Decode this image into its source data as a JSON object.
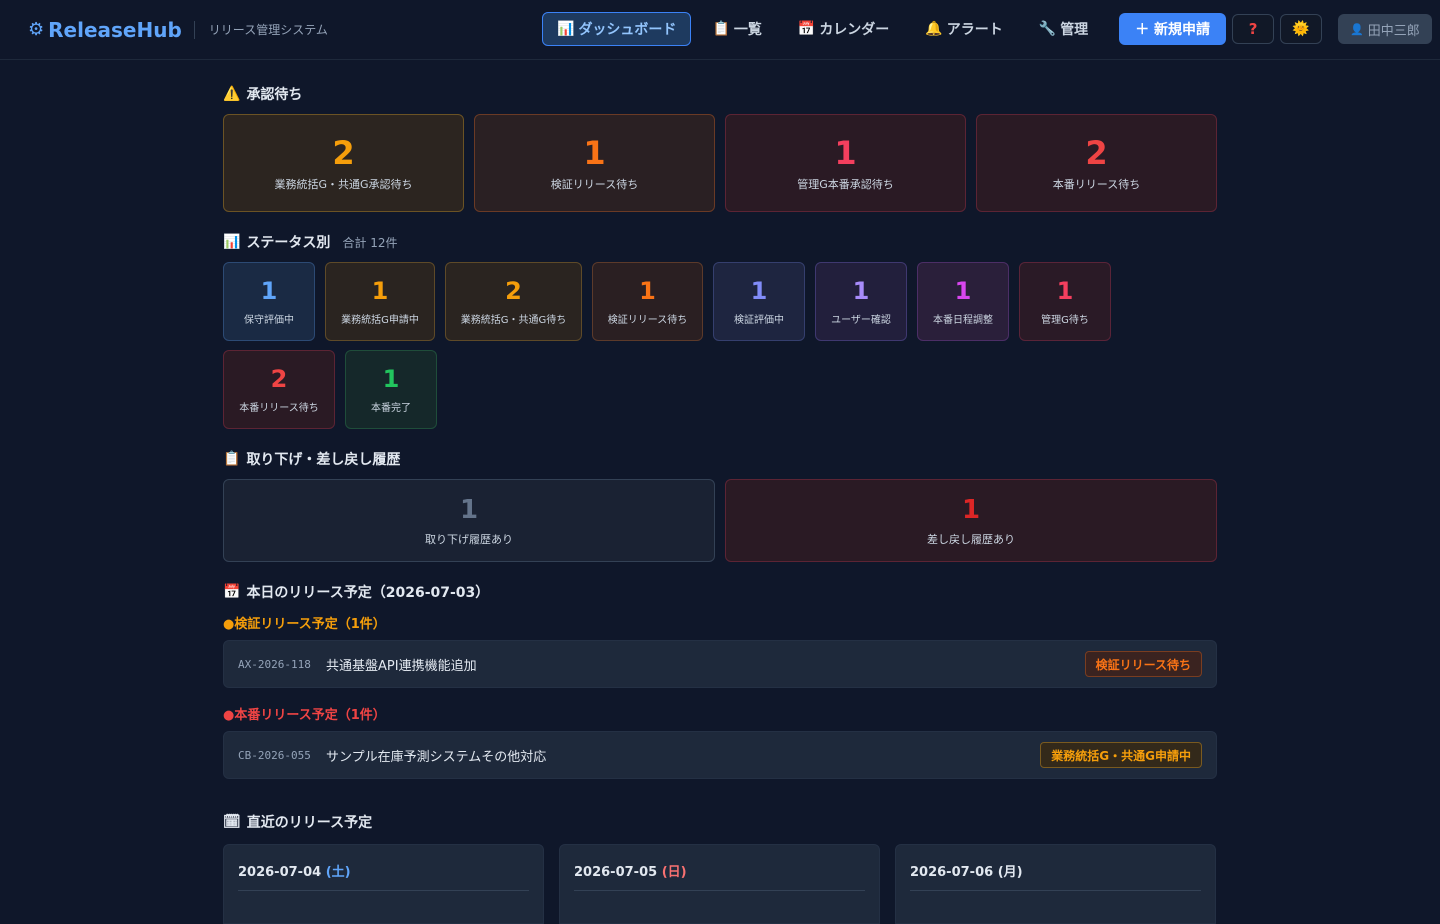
{
  "header": {
    "brand": "ReleaseHub",
    "brand_icon": "gear-icon",
    "subtitle": "リリース管理システム",
    "nav": [
      {
        "icon": "📊",
        "label": "ダッシュボード",
        "active": true
      },
      {
        "icon": "📋",
        "label": "一覧"
      },
      {
        "icon": "📅",
        "label": "カレンダー"
      },
      {
        "icon": "🔔",
        "label": "アラート"
      },
      {
        "icon": "🔧",
        "label": "管理"
      }
    ],
    "new_button": "＋ 新規申請",
    "help_label": "?",
    "theme_icon": "🌞",
    "user": "田中三郎",
    "user_icon": "👤"
  },
  "approval": {
    "icon": "⚠️",
    "title": "承認待ち",
    "cards": [
      {
        "value": "2",
        "label": "業務統括G・共通G承認待ち",
        "color": "#f59e0b",
        "bg": "#2c2520",
        "border": "#6b5324"
      },
      {
        "value": "1",
        "label": "検証リリース待ち",
        "color": "#f97316",
        "bg": "#2a2023",
        "border": "#6a3a25"
      },
      {
        "value": "1",
        "label": "管理G本番承認待ち",
        "color": "#f43f5e",
        "bg": "#2a1a24",
        "border": "#5c2434"
      },
      {
        "value": "2",
        "label": "本番リリース待ち",
        "color": "#ef4444",
        "bg": "#2a1a24",
        "border": "#5c2434"
      }
    ]
  },
  "status": {
    "icon": "📊",
    "title": "ステータス別",
    "total": "合計 12件",
    "cards": [
      {
        "value": "1",
        "label": "保守評価中",
        "color": "#60a5fa",
        "bg": "#1a2a44",
        "border": "#2c4a74"
      },
      {
        "value": "1",
        "label": "業務統括G申請中",
        "color": "#f59e0b",
        "bg": "#2a2420",
        "border": "#5e4a28"
      },
      {
        "value": "2",
        "label": "業務統括G・共通G待ち",
        "color": "#f59e0b",
        "bg": "#2a2420",
        "border": "#5e4a28"
      },
      {
        "value": "1",
        "label": "検証リリース待ち",
        "color": "#f97316",
        "bg": "#2a1f22",
        "border": "#5c3a2a"
      },
      {
        "value": "1",
        "label": "検証評価中",
        "color": "#818cf8",
        "bg": "#1e2540",
        "border": "#353f6e"
      },
      {
        "value": "1",
        "label": "ユーザー確認",
        "color": "#a78bfa",
        "bg": "#221f3c",
        "border": "#3f3870"
      },
      {
        "value": "1",
        "label": "本番日程調整",
        "color": "#d946ef",
        "bg": "#2a1f3a",
        "border": "#4c2e66"
      },
      {
        "value": "1",
        "label": "管理G待ち",
        "color": "#f43f5e",
        "bg": "#2a1a26",
        "border": "#5a2438"
      },
      {
        "value": "2",
        "label": "本番リリース待ち",
        "color": "#ef4444",
        "bg": "#2a1a24",
        "border": "#5c2434"
      },
      {
        "value": "1",
        "label": "本番完了",
        "color": "#22c55e",
        "bg": "#15282a",
        "border": "#1f4d3a"
      }
    ]
  },
  "history": {
    "icon": "📋",
    "title": "取り下げ・差し戻し履歴",
    "cards": [
      {
        "value": "1",
        "label": "取り下げ履歴あり",
        "color": "#64748b",
        "bg": "#1a2233",
        "border": "#334155"
      },
      {
        "value": "1",
        "label": "差し戻し履歴あり",
        "color": "#dc2626",
        "bg": "#2a1a24",
        "border": "#5c2434"
      }
    ]
  },
  "today": {
    "icon": "📅",
    "title": "本日のリリース予定（2026-07-03）",
    "groups": [
      {
        "heading": "●検証リリース予定（1件）",
        "color": "#f59e0b",
        "items": [
          {
            "id": "AX-2026-118",
            "name": "共通基盤API連携機能追加",
            "badge": "検証リリース待ち",
            "badge_color": "#f97316",
            "badge_bg": "#3a2320",
            "badge_border": "#7a3d20"
          }
        ]
      },
      {
        "heading": "●本番リリース予定（1件）",
        "color": "#ef4444",
        "items": [
          {
            "id": "CB-2026-055",
            "name": "サンプル在庫予測システムその他対応",
            "badge": "業務統括G・共通G申請中",
            "badge_color": "#f59e0b",
            "badge_bg": "#33291a",
            "badge_border": "#7a5a1f"
          }
        ]
      }
    ]
  },
  "upcoming": {
    "icon": "🗓",
    "title": "直近のリリース予定",
    "days": [
      {
        "date": "2026-07-04",
        "dow": "(土)",
        "dow_color": "#60a5fa"
      },
      {
        "date": "2026-07-05",
        "dow": "(日)",
        "dow_color": "#f87171"
      },
      {
        "date": "2026-07-06",
        "dow": "(月)",
        "dow_color": "#e2e8f0"
      }
    ]
  }
}
